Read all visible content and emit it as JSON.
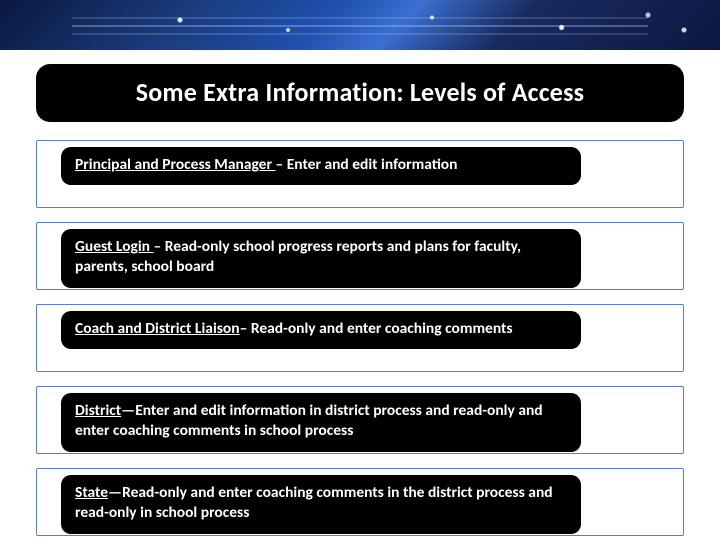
{
  "banner": {
    "name": "decorative-banner"
  },
  "title": "Some Extra Information: Levels of Access",
  "items": [
    {
      "role": "Principal and Process Manager ",
      "sep": "– ",
      "desc": "Enter and edit information"
    },
    {
      "role": "Guest Login ",
      "sep": "– ",
      "desc": "Read-only school progress reports and plans for faculty, parents, school board"
    },
    {
      "role": "Coach and District Liaison",
      "sep": "– ",
      "desc": "Read-only and enter coaching comments"
    },
    {
      "role": "District",
      "sep": "—",
      "desc": "Enter and edit information in district process and read-only and enter coaching comments in school process"
    },
    {
      "role": "State",
      "sep": "—",
      "desc": "Read-only and enter coaching comments in the district process and read-only in school process"
    }
  ]
}
